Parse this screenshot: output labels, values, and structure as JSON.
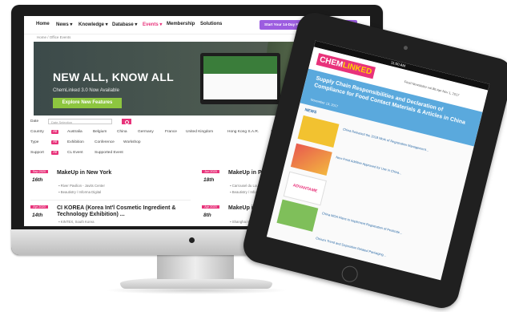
{
  "nav": {
    "items": [
      "Home",
      "News",
      "Knowledge",
      "Database",
      "Events",
      "Membership",
      "Solutions"
    ],
    "active": "Events",
    "trial_text": "Start Your 14-Day FREE Trial",
    "trial_button": "Apply Now"
  },
  "breadcrumb": "Home / Office Events",
  "hero": {
    "title": "NEW ALL, KNOW ALL",
    "subtitle": "ChemLinked 3.0 Now Available",
    "button": "Explore New Features"
  },
  "filters": {
    "date_label": "Date",
    "date_placeholder": "Date Selection",
    "country_label": "Country",
    "country_all": "All",
    "countries": [
      "Australia",
      "Belgium",
      "China",
      "Germany",
      "France",
      "United Kingdom",
      "Hong Kong S.A.R.",
      "South Korea",
      "M"
    ],
    "type_label": "Type",
    "type_all": "All",
    "types": [
      "Exhibition",
      "Conference",
      "Workshop"
    ],
    "support_label": "Support",
    "support_all": "All",
    "supports": [
      "CL Event",
      "Supported Event"
    ]
  },
  "events": [
    {
      "month": "Sep 2020",
      "day": "16th",
      "title": "MakeUp in New York",
      "venue": "River Pavilion - Javits Center",
      "org": "Beautistry / Informa Digital"
    },
    {
      "month": "Jun 2020",
      "day": "18th",
      "title": "MakeUp in Paris",
      "venue": "Carrousel du Louvre, Paris",
      "org": "Beautistry / Informa Digital"
    },
    {
      "month": "Apr 2020",
      "day": "14th",
      "title": "CI KOREA (Korea Int'l Cosmetic Ingredient &",
      "title2": "Technology Exhibition) ...",
      "venue": "KINTEX, South Korea"
    },
    {
      "month": "Apr 2020",
      "day": "8th",
      "title": "MakeUp in Shanghai",
      "venue": "Shanghai Exhibition"
    }
  ],
  "tablet": {
    "time": "11:00 AM",
    "logo_main": "CHEM",
    "logo_accent": "LINKED",
    "note": "Food Newsletter vol.86 Apr Nov 1, 2017",
    "banner": "Supply Chain Responsibilities and Declaration of Compliance for Food Contact Materials & Articles in China",
    "banner_date": "November 13, 2017",
    "news_heading": "NEWS",
    "items": [
      "China Released the 2018 Work of Registration Management...",
      "New Food Additive Approved for Use in China...",
      "ADVANTAME",
      "China MOA Plans to Implement Registration of Pesticide...",
      "China's Trend and Deposition Related Packaging..."
    ]
  },
  "colors": {
    "accent": "#e8327a",
    "green": "#8dc63f",
    "purple": "#9c5de0",
    "blue": "#5aa9dd"
  }
}
